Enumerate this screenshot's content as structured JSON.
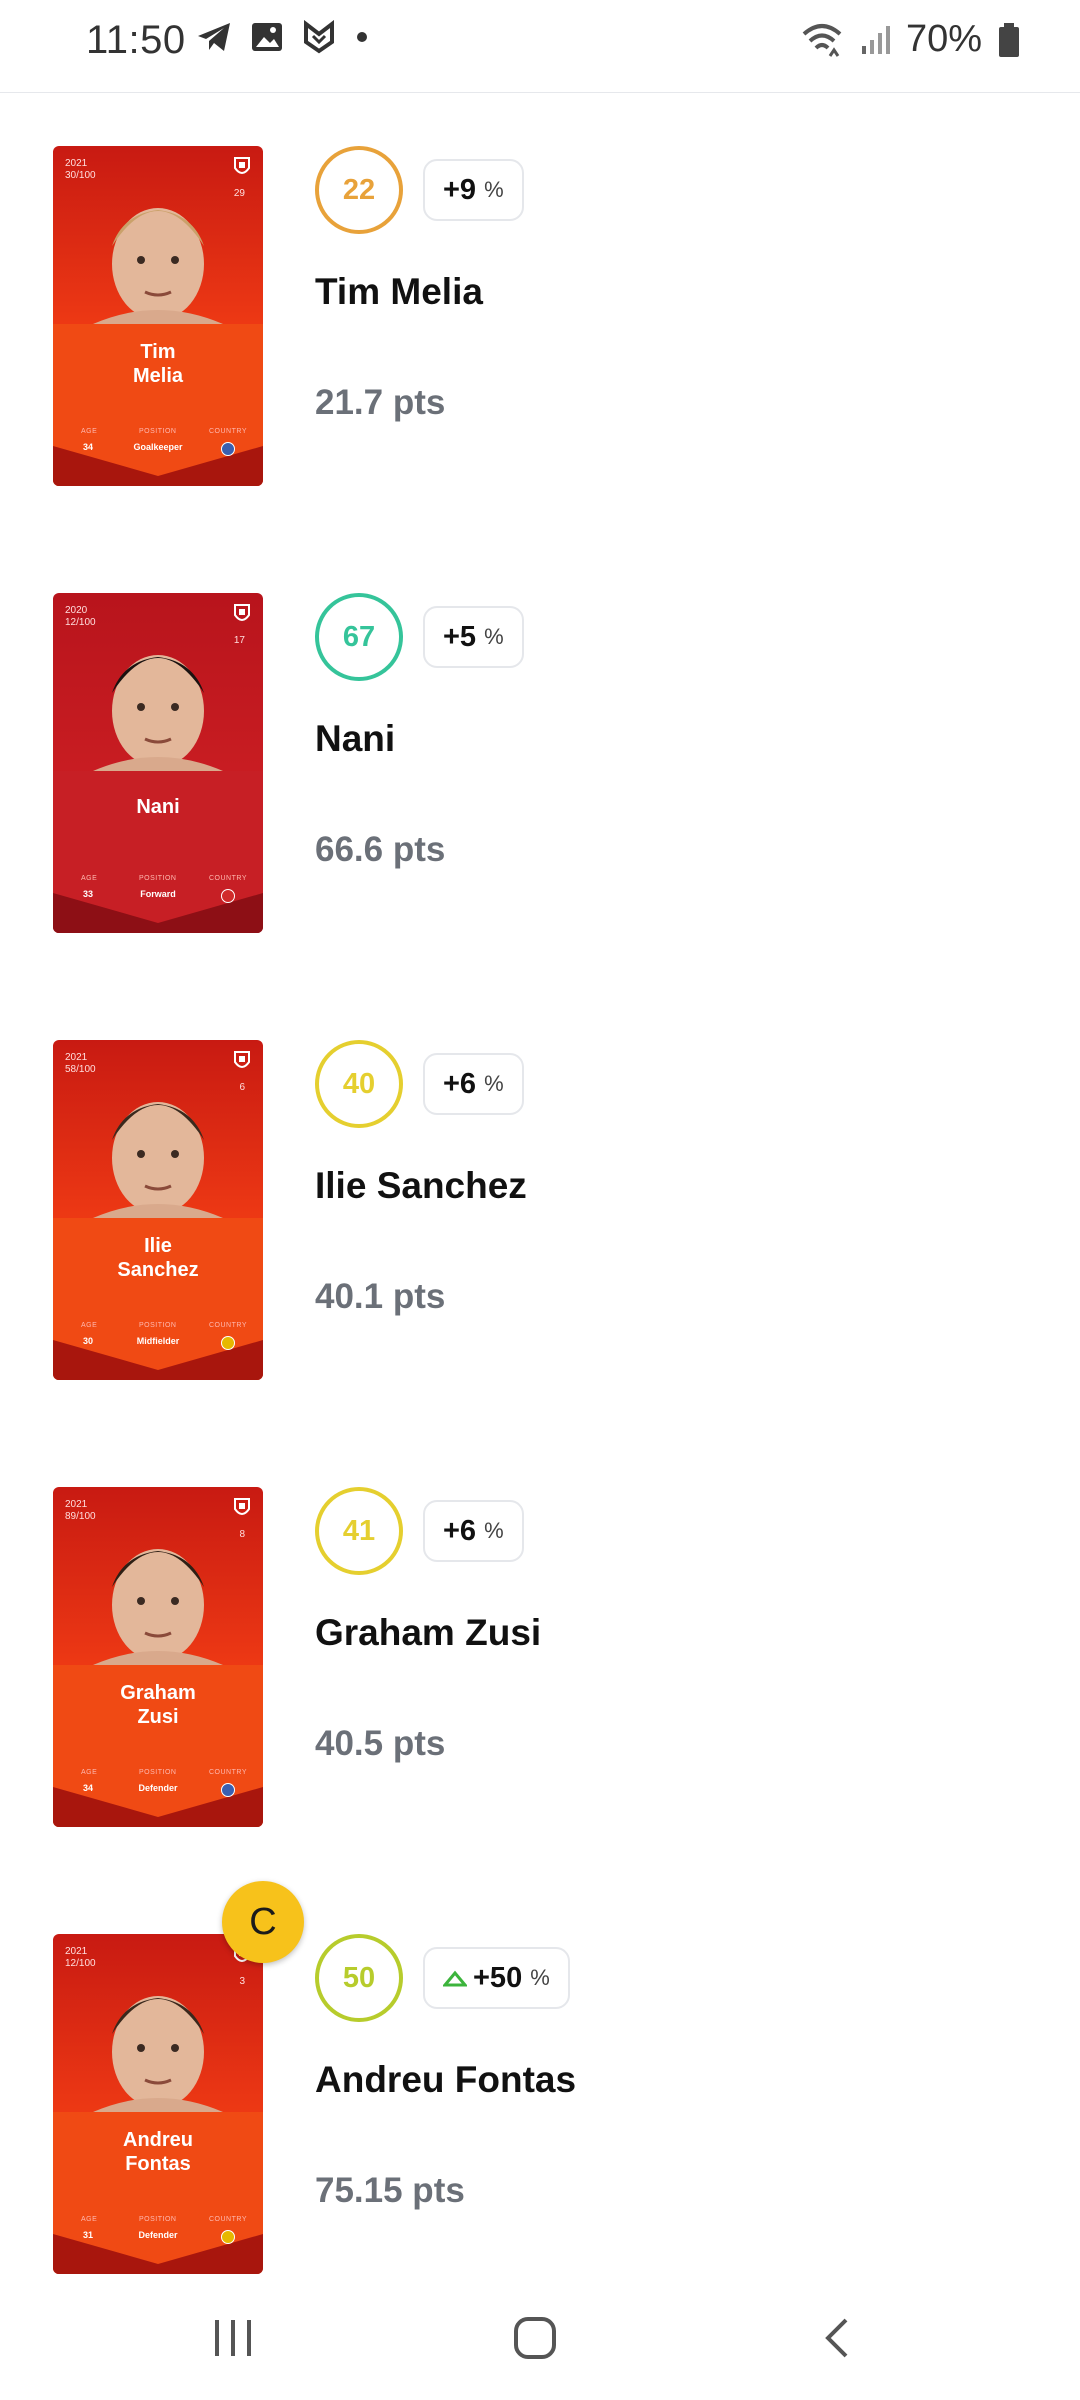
{
  "status_bar": {
    "time": "11:50",
    "battery": "70%",
    "left_icons": [
      "telegram-icon",
      "gallery-icon",
      "vpn-icon",
      "dot-icon"
    ],
    "right_icons": [
      "wifi-icon",
      "signal-icon",
      "battery-icon"
    ]
  },
  "players": [
    {
      "card": {
        "year": "2021",
        "serial": "30/100",
        "number": "29",
        "first": "Tim",
        "last": "Melia",
        "age": "34",
        "position": "Goalkeeper",
        "labels": {
          "age": "AGE",
          "position": "POSITION",
          "country": "COUNTRY"
        }
      },
      "score": "22",
      "score_color": "#e8a23a",
      "delta": "+9",
      "delta_unit": "%",
      "delta_arrow": false,
      "name": "Tim Melia",
      "points": "21.7 pts"
    },
    {
      "card": {
        "year": "2020",
        "serial": "12/100",
        "number": "17",
        "first": "Nani",
        "last": "",
        "age": "33",
        "position": "Forward",
        "labels": {
          "age": "AGE",
          "position": "POSITION",
          "country": "COUNTRY"
        }
      },
      "score": "67",
      "score_color": "#35c49a",
      "delta": "+5",
      "delta_unit": "%",
      "delta_arrow": false,
      "name": "Nani",
      "points": "66.6 pts"
    },
    {
      "card": {
        "year": "2021",
        "serial": "58/100",
        "number": "6",
        "first": "Ilie",
        "last": "Sanchez",
        "age": "30",
        "position": "Midfielder",
        "labels": {
          "age": "AGE",
          "position": "POSITION",
          "country": "COUNTRY"
        }
      },
      "score": "40",
      "score_color": "#e5cf2f",
      "delta": "+6",
      "delta_unit": "%",
      "delta_arrow": false,
      "name": "Ilie Sanchez",
      "points": "40.1 pts"
    },
    {
      "card": {
        "year": "2021",
        "serial": "89/100",
        "number": "8",
        "first": "Graham",
        "last": "Zusi",
        "age": "34",
        "position": "Defender",
        "labels": {
          "age": "AGE",
          "position": "POSITION",
          "country": "COUNTRY"
        }
      },
      "score": "41",
      "score_color": "#e5cf2f",
      "delta": "+6",
      "delta_unit": "%",
      "delta_arrow": false,
      "name": "Graham Zusi",
      "points": "40.5 pts"
    },
    {
      "card": {
        "year": "2021",
        "serial": "12/100",
        "number": "3",
        "first": "Andreu",
        "last": "Fontas",
        "age": "31",
        "position": "Defender",
        "labels": {
          "age": "AGE",
          "position": "POSITION",
          "country": "COUNTRY"
        }
      },
      "score": "50",
      "score_color": "#b7cc2c",
      "delta": "+50",
      "delta_unit": "%",
      "delta_arrow": true,
      "name": "Andreu Fontas",
      "points": "75.15 pts",
      "captain": "C"
    }
  ],
  "nav_bar": {
    "icons": [
      "recent-apps-icon",
      "home-icon",
      "back-icon"
    ]
  }
}
